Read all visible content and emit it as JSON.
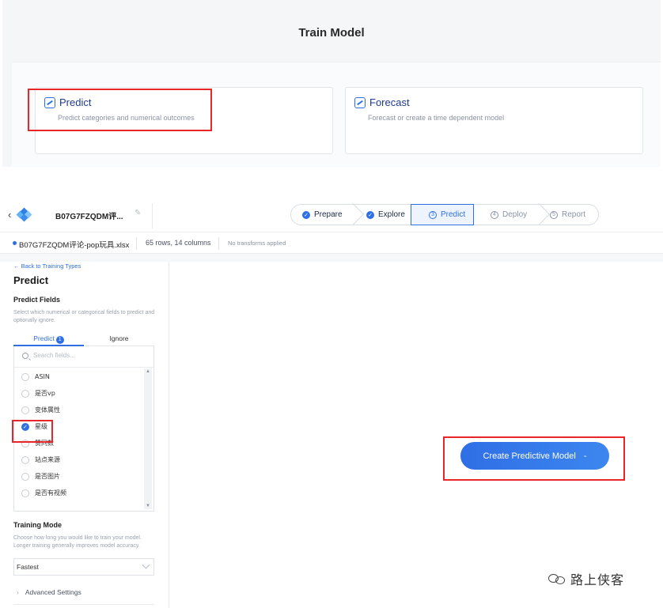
{
  "train_model": {
    "title": "Train Model",
    "cards": [
      {
        "title": "Predict",
        "subtitle": "Predict categories and numerical outcomes"
      },
      {
        "title": "Forecast",
        "subtitle": "Forecast or create a time dependent model"
      }
    ]
  },
  "header": {
    "project_name": "B07G7FZQDM评...",
    "steps": [
      {
        "label": "Prepare",
        "state": "done"
      },
      {
        "label": "Explore",
        "state": "done"
      },
      {
        "label": "Predict",
        "state": "active",
        "number": "3"
      },
      {
        "label": "Deploy",
        "state": "todo",
        "number": "4"
      },
      {
        "label": "Report",
        "state": "todo",
        "number": "5"
      }
    ]
  },
  "filebar": {
    "filename": "B07G7FZQDM评论-pop玩具.xlsx",
    "rows_cols": "65 rows, 14 columns",
    "transforms": "No transforms applied"
  },
  "left_panel": {
    "back_link": "← Back to Training Types",
    "title": "Predict",
    "predict_fields_title": "Predict Fields",
    "predict_fields_help": "Select which numerical or categorical fields to predict and optionally ignore.",
    "tabs": [
      {
        "label": "Predict",
        "badge": "1"
      },
      {
        "label": "Ignore"
      }
    ],
    "search_placeholder": "Search fields...",
    "fields": [
      {
        "label": "ASIN",
        "selected": false
      },
      {
        "label": "是否vp",
        "selected": false
      },
      {
        "label": "变体属性",
        "selected": false
      },
      {
        "label": "星级",
        "selected": true
      },
      {
        "label": "赞同数",
        "selected": false
      },
      {
        "label": "站点来源",
        "selected": false
      },
      {
        "label": "是否图片",
        "selected": false
      },
      {
        "label": "是否有视频",
        "selected": false
      }
    ],
    "training_mode_title": "Training Mode",
    "training_mode_help": "Choose how long you would like to train your model. Longer training generally improves model accuracy.",
    "training_mode_value": "Fastest",
    "advanced_label": "Advanced Settings"
  },
  "create_button": {
    "label": "Create Predictive Model",
    "suffix": "-"
  },
  "watermark": {
    "text": "路上侠客"
  },
  "colors": {
    "accent": "#2f6fe6",
    "highlight": "#e8262a"
  }
}
